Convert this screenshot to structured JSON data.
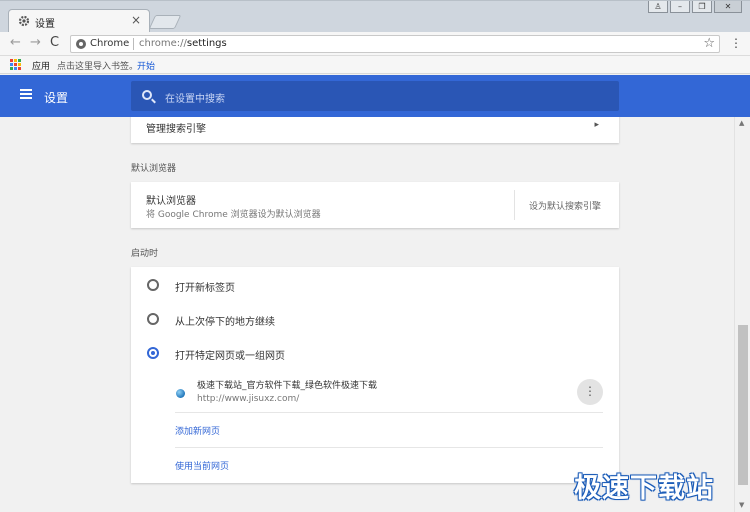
{
  "tab": {
    "title": "设置",
    "close": "×"
  },
  "window_controls": {
    "user": "♙",
    "minimize": "–",
    "restore": "❐",
    "close": "✕"
  },
  "toolbar": {
    "back": "←",
    "forward": "→",
    "reload": "C",
    "site_chip": "Chrome",
    "url_scheme": "chrome://",
    "url_path": "settings",
    "star": "☆",
    "menu": "⋮"
  },
  "bookmarks": {
    "apps_label": "应用",
    "hint": "点击这里导入书签。",
    "start_link": "开始",
    "apps_colors": [
      "#e94235",
      "#fbbc04",
      "#34a853",
      "#4285f4",
      "#e94235",
      "#fbbc04",
      "#34a853",
      "#4285f4",
      "#e94235"
    ]
  },
  "header": {
    "title": "设置",
    "search_placeholder": "在设置中搜索",
    "color": "#3367d6"
  },
  "search_engine": {
    "manage_label": "管理搜索引擎",
    "chevron": "▸"
  },
  "default_browser": {
    "section_label": "默认浏览器",
    "title": "默认浏览器",
    "subtitle": "将 Google Chrome 浏览器设为默认浏览器",
    "button": "设为默认搜索引擎"
  },
  "startup": {
    "section_label": "启动时",
    "options": [
      {
        "label": "打开新标签页",
        "checked": false
      },
      {
        "label": "从上次停下的地方继续",
        "checked": false
      },
      {
        "label": "打开特定网页或一组网页",
        "checked": true
      }
    ],
    "pages": [
      {
        "title": "极速下载站_官方软件下载_绿色软件极速下载",
        "url": "http://www.jisuxz.com/"
      }
    ],
    "more": "⋮",
    "add_page": "添加新网页",
    "use_current": "使用当前网页"
  },
  "scrollbar": {
    "up": "▲",
    "down": "▼"
  },
  "watermark": "极速下载站"
}
